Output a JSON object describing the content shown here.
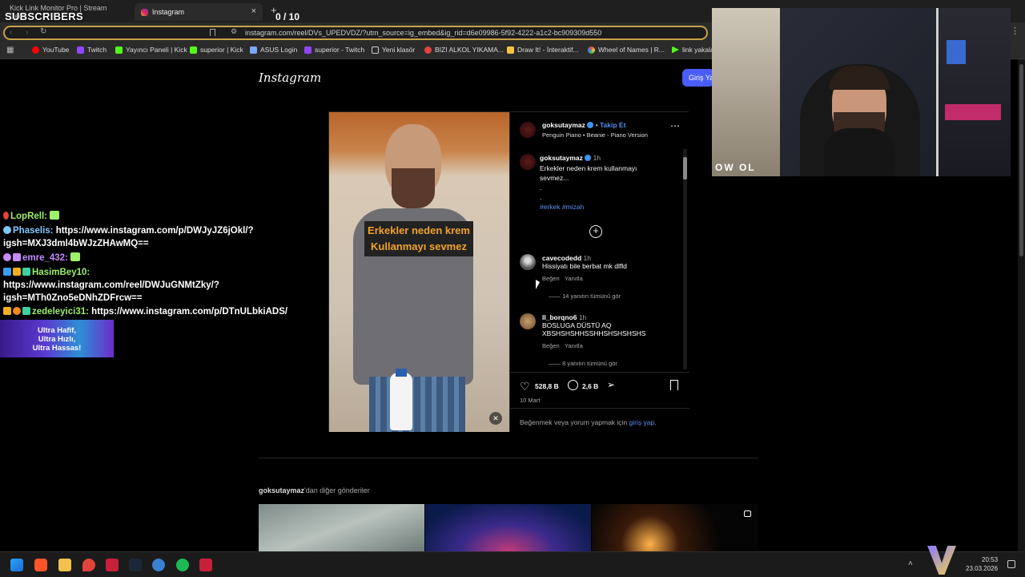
{
  "overlay": {
    "subscribers_title": "SUBSCRIBERS",
    "counter": "0 / 10"
  },
  "browser": {
    "tabs": [
      {
        "label": "Kick Link Monitor Pro | Stream Deck"
      },
      {
        "label": "Instagram"
      }
    ],
    "url": "instagram.com/reel/DVs_UPEDVDZ/?utm_source=ig_embed&ig_rid=d6e09986-5f92-4222-a1c2-bc909309d550",
    "bookmarks": [
      {
        "label": "YouTube",
        "color": "#ff0000"
      },
      {
        "label": "Twitch",
        "color": "#9146ff"
      },
      {
        "label": "Yayıncı Paneli | Kick",
        "color": "#53fc18"
      },
      {
        "label": "superior | Kick",
        "color": "#53fc18"
      },
      {
        "label": "ASUS Login",
        "color": "#7aa7ff"
      },
      {
        "label": "superior - Twitch",
        "color": "#9146ff"
      },
      {
        "label": "Yeni klasör",
        "color": "#cccccc"
      },
      {
        "label": "BIZI ALKOL YIKAMA...",
        "color": "#e0443b"
      },
      {
        "label": "Draw It! - İnteraktif...",
        "color": "#f4c542"
      },
      {
        "label": "Wheel of Names | R...",
        "color": "#e94b3c"
      },
      {
        "label": "link yakala",
        "color": "#53fc18"
      }
    ]
  },
  "chat": [
    {
      "user": "LopRell:",
      "text": "",
      "color": "#9cf06a"
    },
    {
      "user": "Phaselis:",
      "text": "https://www.instagram.com/p/DWJyJZ6jOkl/?",
      "color": "#7ec8ff"
    },
    {
      "user": "",
      "text": "igsh=MXJ3dml4bWJzZHAwMQ==",
      "color": "#ffffff"
    },
    {
      "user": "emre_432:",
      "text": "",
      "color": "#c58bff"
    },
    {
      "user": "HasimBey10:",
      "text": "",
      "color": "#9cf06a"
    },
    {
      "user": "",
      "text": "https://www.instagram.com/reel/DWJuGNMtZky/?",
      "color": "#ffffff"
    },
    {
      "user": "",
      "text": "igsh=MTh0Zno5eDNhZDFrcw==",
      "color": "#ffffff"
    },
    {
      "user": "zedeleyici31:",
      "text": "https://www.instagram.com/p/DTnULbkiADS/",
      "color": "#9cf06a"
    }
  ],
  "ad": {
    "line1": "Ultra Hafif,",
    "line2": "Ultra Hızlı,",
    "line3": "Ultra Hassas!"
  },
  "instagram": {
    "logo": "Instagram",
    "login_button": "Giriş Yap",
    "video_caption_line1": "Erkekler neden krem",
    "video_caption_line2": "Kullanmayı sevmez",
    "author": "goksutaymaz",
    "follow": "Takip Et",
    "audio": "Penguin Piano • Beanie - Piano Version",
    "caption_time": "1h",
    "caption_text_1": "Erkekler neden krem kullanmayı",
    "caption_text_2": "sevmez...",
    "caption_dot1": ".",
    "caption_dot2": ".",
    "hashtags": "#erkek #mizah",
    "comments": [
      {
        "user": "cavecodedd",
        "time": "1h",
        "text": "Hissiyatı bile berbat mk dlfld",
        "text2": "",
        "like": "Beğen",
        "reply": "Yanıtla",
        "more": "14 yanıtın tümünü gör"
      },
      {
        "user": "ll_borqno6",
        "time": "1h",
        "text": "BOSLUGA DÜSTÜ AQ",
        "text2": "XBSHSHSHHSSHHSHSHSHSHS",
        "like": "Beğen",
        "reply": "Yanıtla",
        "more": "8 yanıtın tümünü gör"
      }
    ],
    "likes": "528,8 B",
    "comment_count": "2,6 B",
    "date": "10 Mart",
    "login_prompt": "Beğenmek veya yorum yapmak için",
    "login_link": "giriş yap.",
    "more_posts_user": "goksutaymaz",
    "more_posts_suffix": "'dan diğer gönderiler"
  },
  "cam": {
    "nameplate": "OW OL"
  },
  "taskbar": {
    "time": "20:53",
    "date": "23.03.2026"
  }
}
